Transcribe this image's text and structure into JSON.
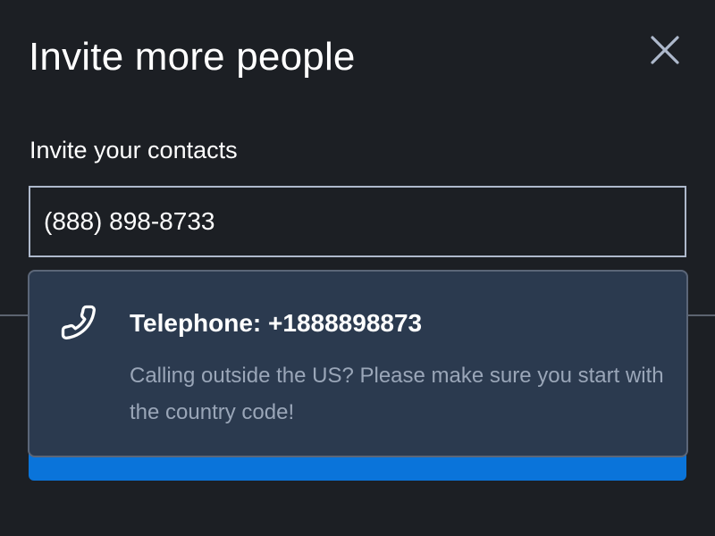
{
  "dialog": {
    "title": "Invite more people",
    "close_icon": "close-icon"
  },
  "contacts": {
    "label": "Invite your contacts",
    "input_value": "(888) 898-8733"
  },
  "suggestion": {
    "icon": "phone-icon",
    "title": "Telephone: +1888898873",
    "hint": "Calling outside the US? Please make sure you start with the country code!"
  },
  "colors": {
    "background": "#1c1f24",
    "dropdown_background": "#2b3a4f",
    "accent": "#0a74da",
    "input_border": "#aeb9cc",
    "hint_text": "#9aa6b8"
  }
}
